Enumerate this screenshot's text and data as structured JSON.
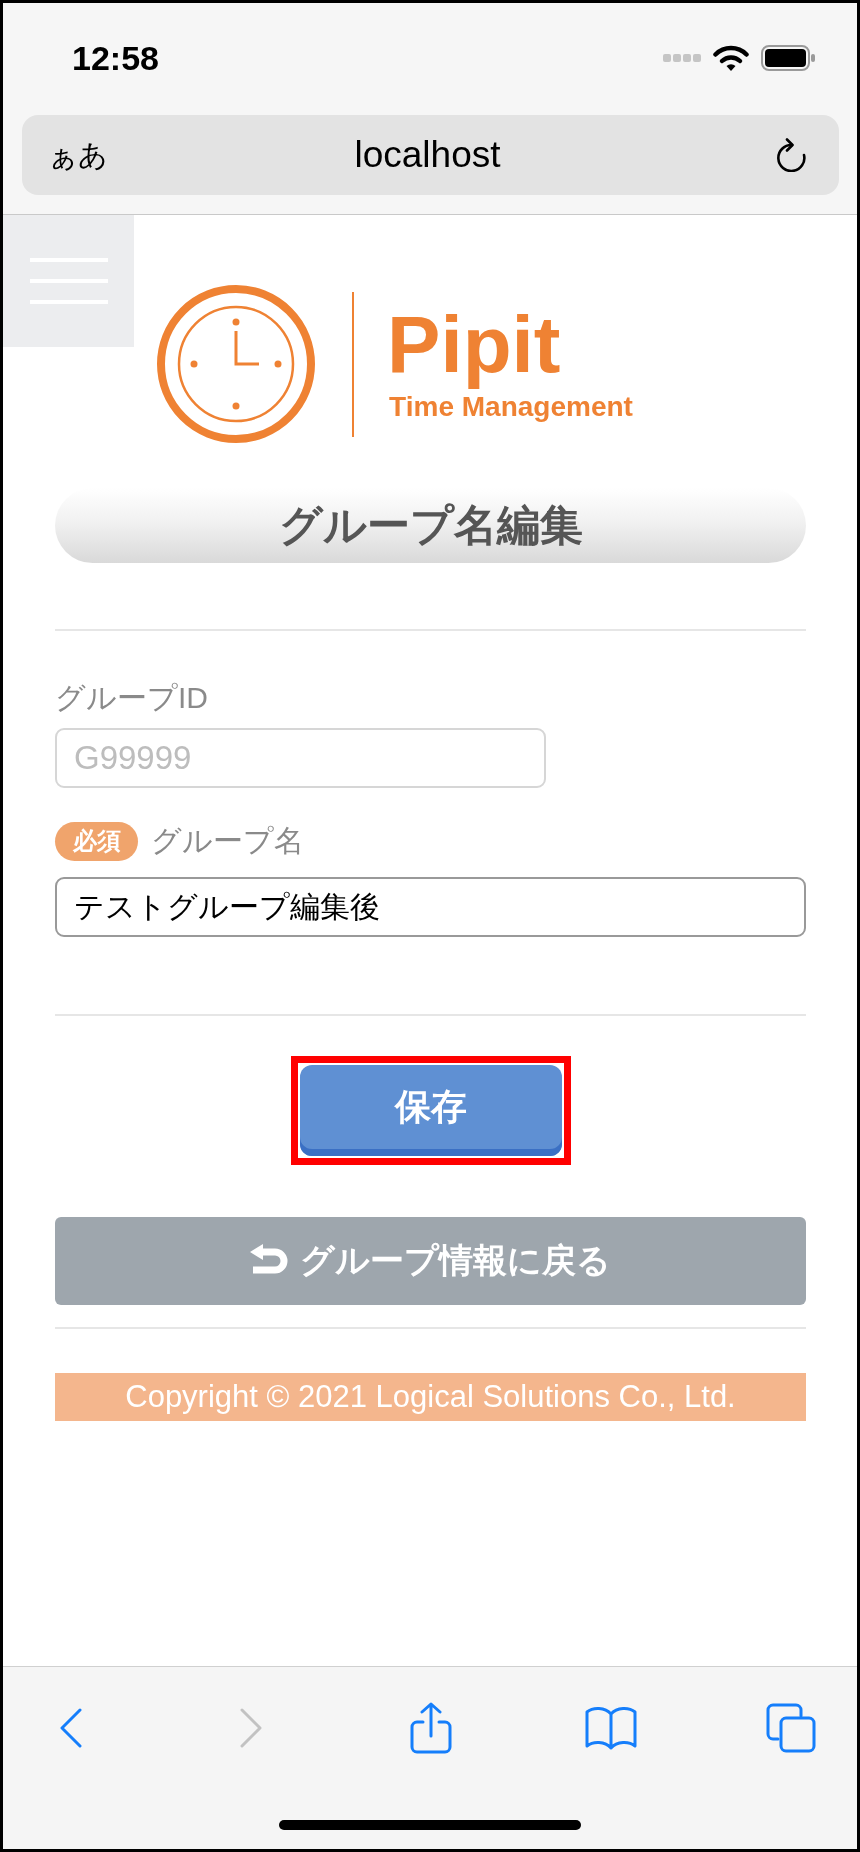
{
  "status_bar": {
    "time": "12:58"
  },
  "address_bar": {
    "text_size_button": "ぁあ",
    "url": "localhost"
  },
  "logo": {
    "name": "Pipit",
    "tagline": "Time Management"
  },
  "page_title": "グループ名編集",
  "form": {
    "fields": [
      {
        "label": "グループID",
        "value": "G99999",
        "disabled": true
      },
      {
        "label": "グループ名",
        "value": "テストグループ編集後",
        "disabled": false,
        "badge": "必須"
      }
    ]
  },
  "buttons": [
    {
      "kind": "save",
      "label": "保存",
      "highlighted": true
    },
    {
      "kind": "back",
      "label": "グループ情報に戻る",
      "highlighted": false
    }
  ],
  "footer": {
    "copyright": "Copyright © 2021 Logical Solutions Co., Ltd."
  },
  "toolbar": [
    {
      "kind": "back",
      "disabled": false
    },
    {
      "kind": "forward",
      "disabled": true
    },
    {
      "kind": "share",
      "disabled": false
    },
    {
      "kind": "bookmarks",
      "disabled": false
    },
    {
      "kind": "tabs",
      "disabled": false
    }
  ]
}
